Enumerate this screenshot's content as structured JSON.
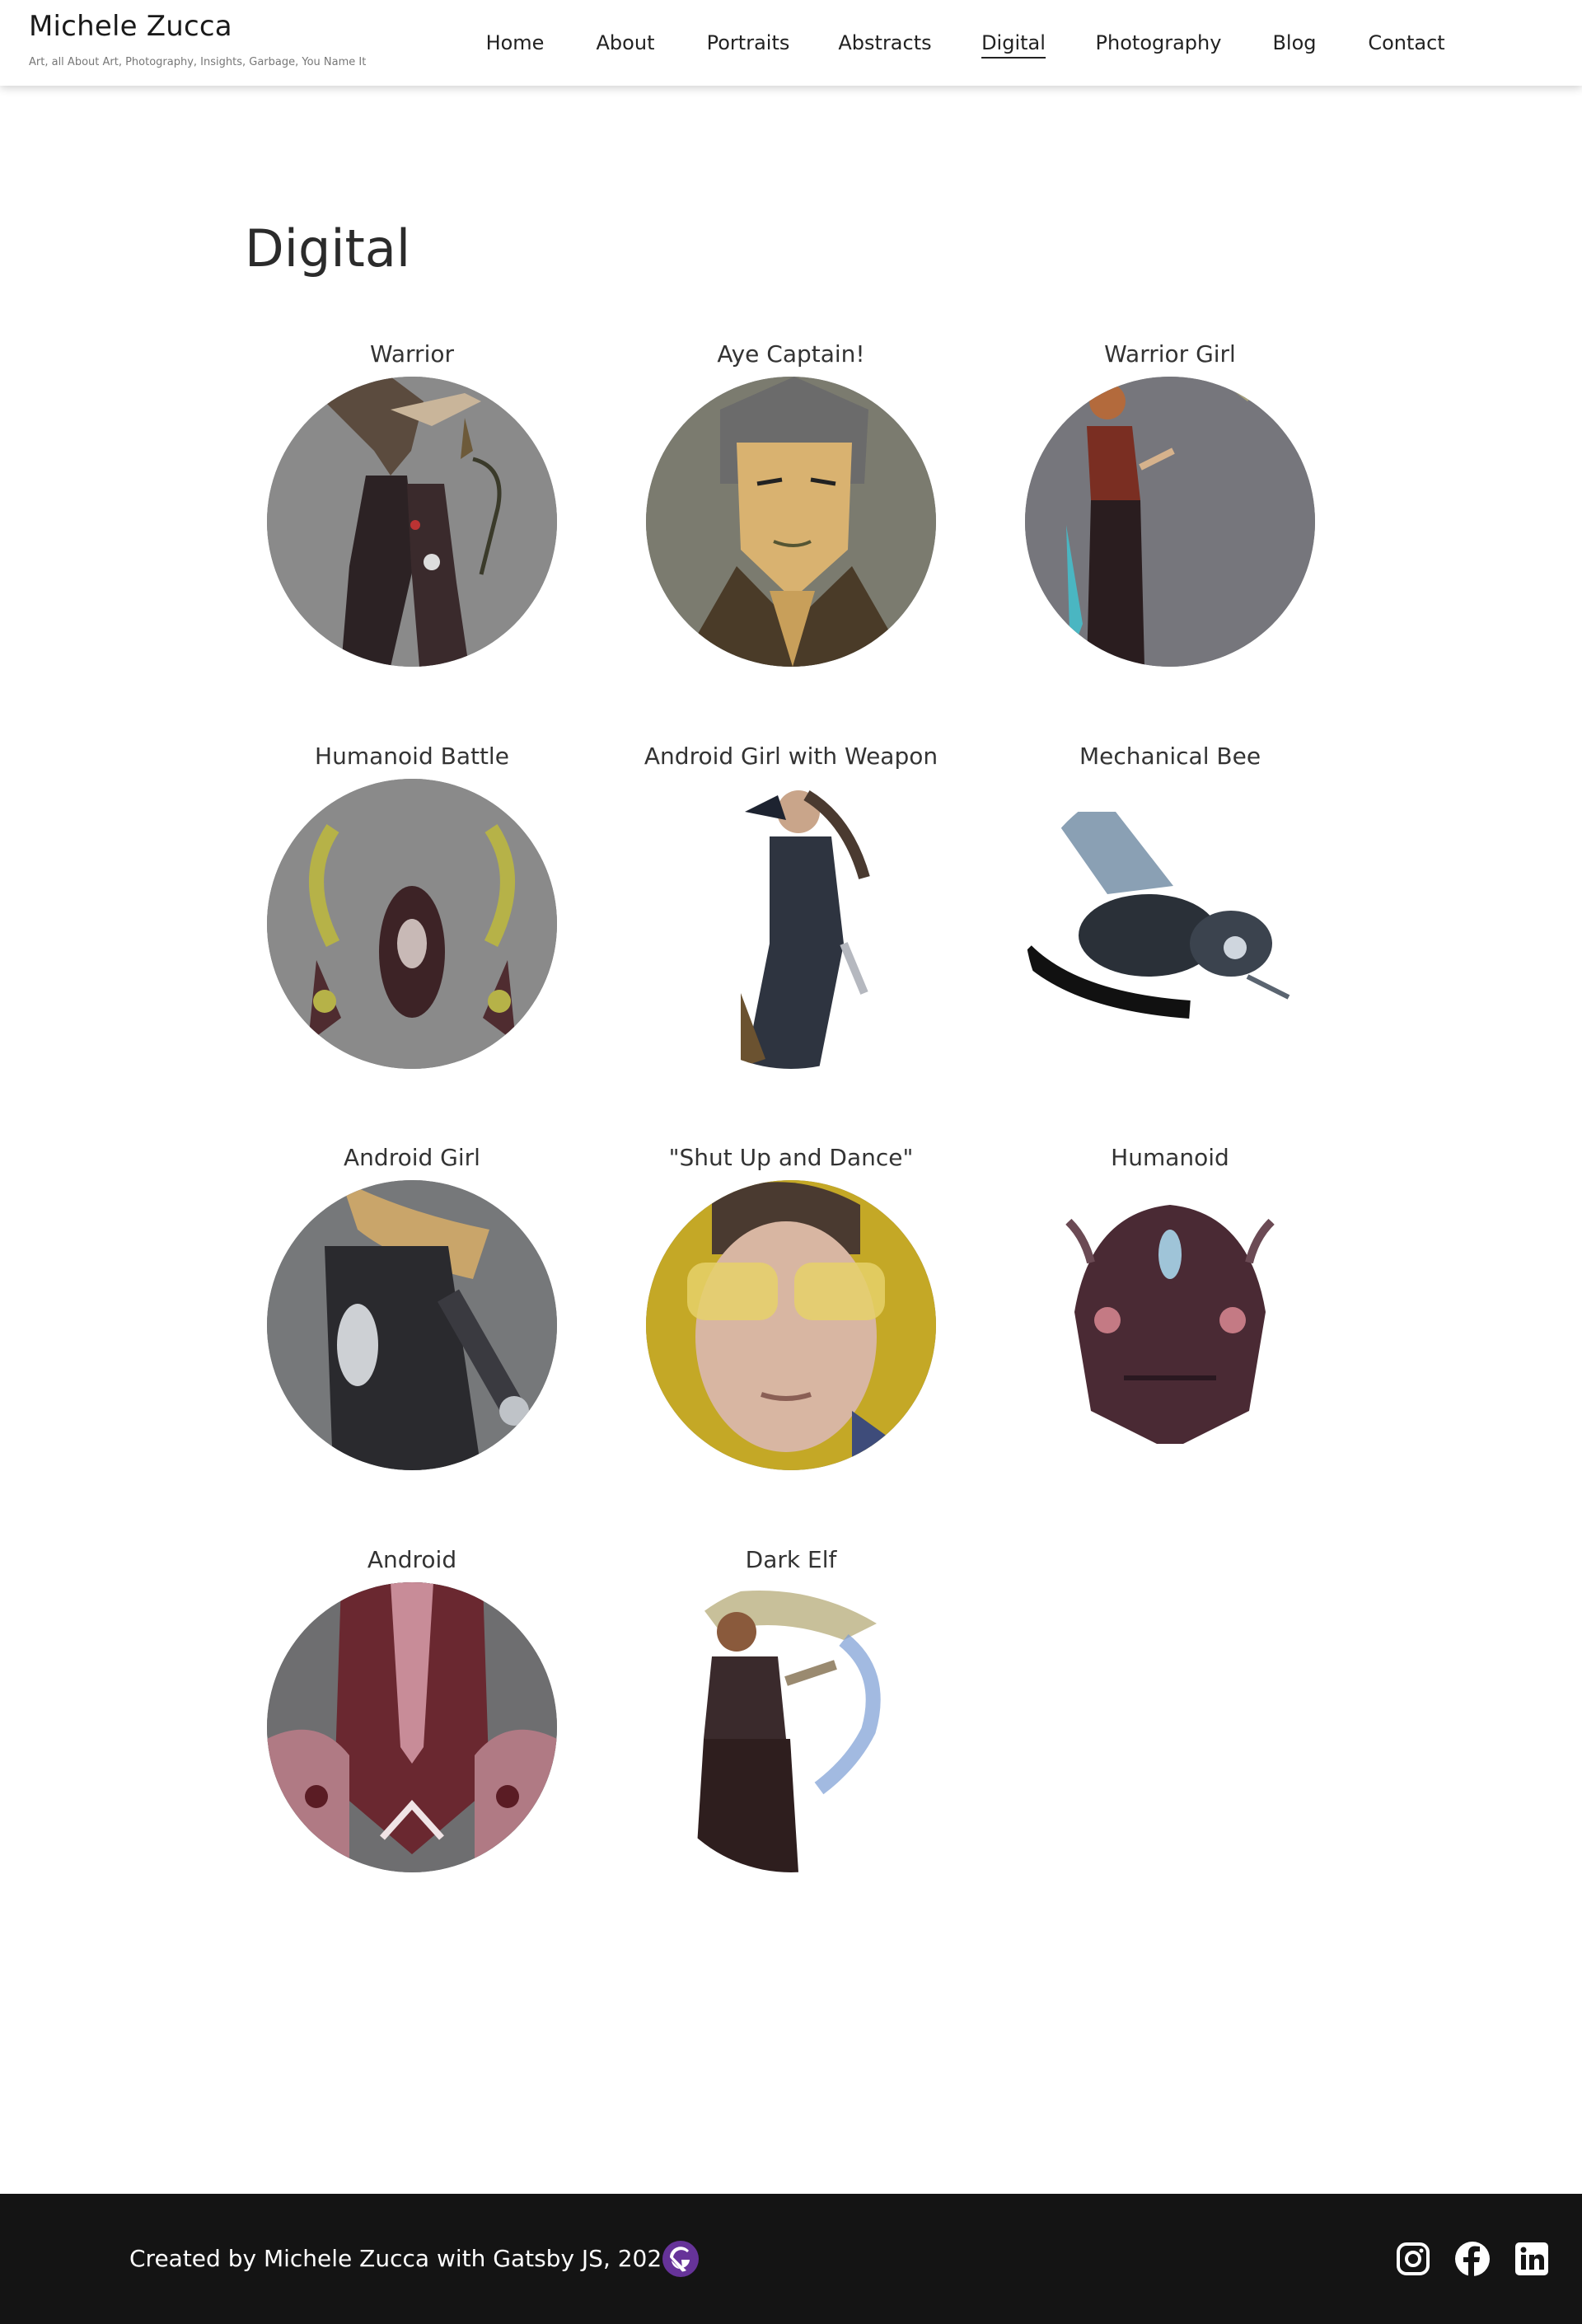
{
  "header": {
    "site_title": "Michele Zucca",
    "tagline": "Art, all About Art, Photography, Insights, Garbage, You Name It",
    "nav": [
      {
        "label": "Home",
        "active": false
      },
      {
        "label": "About",
        "active": false
      },
      {
        "label": "Portraits",
        "active": false
      },
      {
        "label": "Abstracts",
        "active": false
      },
      {
        "label": "Digital",
        "active": true
      },
      {
        "label": "Photography",
        "active": false
      },
      {
        "label": "Blog",
        "active": false
      },
      {
        "label": "Contact",
        "active": false
      }
    ]
  },
  "main": {
    "page_title": "Digital",
    "artworks": [
      {
        "title": "Warrior",
        "icon": "warrior-thumbnail"
      },
      {
        "title": "Aye Captain!",
        "icon": "captain-thumbnail"
      },
      {
        "title": "Warrior Girl",
        "icon": "warrior-girl-thumbnail"
      },
      {
        "title": "Humanoid Battle",
        "icon": "humanoid-battle-thumbnail"
      },
      {
        "title": "Android Girl with Weapon",
        "icon": "android-girl-weapon-thumbnail"
      },
      {
        "title": "Mechanical Bee",
        "icon": "mechanical-bee-thumbnail"
      },
      {
        "title": "Android Girl",
        "icon": "android-girl-thumbnail"
      },
      {
        "title": "\"Shut Up and Dance\"",
        "icon": "shut-up-and-dance-thumbnail"
      },
      {
        "title": "Humanoid",
        "icon": "humanoid-thumbnail"
      },
      {
        "title": "Android",
        "icon": "android-thumbnail"
      },
      {
        "title": "Dark Elf",
        "icon": "dark-elf-thumbnail"
      }
    ]
  },
  "footer": {
    "credit": "Created by Michele Zucca with Gatsby JS, 2020",
    "social": [
      {
        "name": "instagram-icon"
      },
      {
        "name": "facebook-icon"
      },
      {
        "name": "linkedin-icon"
      }
    ]
  },
  "colors": {
    "footer_bg": "#141414",
    "gatsby_purple": "#663399",
    "text_dark": "#222222"
  }
}
